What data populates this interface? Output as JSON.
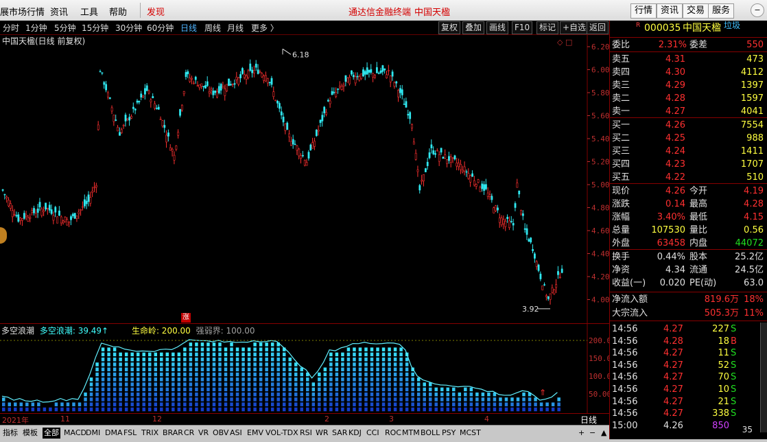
{
  "menubar": {
    "items": [
      "展市场行情",
      "资讯",
      "工具",
      "帮助"
    ],
    "discover": "发现",
    "center_left": "通达信金融终端",
    "center_right": "中国天楹",
    "right_buttons": [
      "行情",
      "资讯",
      "交易",
      "服务"
    ]
  },
  "toolbar": {
    "periods": [
      "分时",
      "1分钟",
      "5分钟",
      "15分钟",
      "30分钟",
      "60分钟",
      "日线",
      "周线",
      "月线",
      "更多 〉"
    ],
    "selected": "日线",
    "buttons": [
      "复权",
      "叠加",
      "画线",
      "F10",
      "标记",
      "+自选",
      "返回"
    ]
  },
  "chart": {
    "title": "中国天楹(日线 前复权)",
    "high_label": "6.18",
    "low_label": "3.92",
    "y_ticks": [
      "6.20",
      "6.00",
      "5.80",
      "5.60",
      "5.40",
      "5.20",
      "5.00",
      "4.80",
      "4.60",
      "4.40",
      "4.20",
      "4.00"
    ],
    "zhang_badge": "涨",
    "colors": {
      "up": "#ff3030",
      "down": "#30e8f0",
      "bg": "#000000",
      "grid": "#800000"
    }
  },
  "indicator": {
    "name": "多空浪潮",
    "label1": "多空浪潮: 39.49↑",
    "label2": "生命岭: 200.00",
    "label3": "强弱界: 100.00",
    "y_ticks": [
      "200.00",
      "150.00",
      "100.00",
      "50.00"
    ]
  },
  "date_axis": {
    "labels": [
      "2021年",
      "11",
      "12",
      "2",
      "3",
      "4"
    ],
    "period_tag": "日线"
  },
  "tabs": [
    "指标",
    "模板",
    "全部",
    "MACD",
    "DMI",
    "DMA",
    "FSL",
    "TRIX",
    "BRAR",
    "CR",
    "VR",
    "OBV",
    "ASI",
    "EMV",
    "VOL-TDX",
    "RSI",
    "WR",
    "SAR",
    "KDJ",
    "CCI",
    "ROC",
    "MTM",
    "BOLL",
    "PSY",
    "MCST"
  ],
  "tabs_selected": "全部",
  "tab_controls": [
    "+",
    "−",
    "▲",
    "◀",
    "▶"
  ],
  "stock": {
    "marker": "R",
    "code": "000035",
    "name": "中国天楹",
    "extra": "垃圾"
  },
  "quote": {
    "weibi_label": "委比",
    "weibi": "2.31%",
    "weicha_label": "委差",
    "weicha": "550",
    "asks": [
      {
        "label": "卖五",
        "price": "4.31",
        "vol": "473"
      },
      {
        "label": "卖四",
        "price": "4.30",
        "vol": "4112"
      },
      {
        "label": "卖三",
        "price": "4.29",
        "vol": "1397"
      },
      {
        "label": "卖二",
        "price": "4.28",
        "vol": "1597"
      },
      {
        "label": "卖一",
        "price": "4.27",
        "vol": "4041"
      }
    ],
    "bids": [
      {
        "label": "买一",
        "price": "4.26",
        "vol": "7554"
      },
      {
        "label": "买二",
        "price": "4.25",
        "vol": "988"
      },
      {
        "label": "买三",
        "price": "4.24",
        "vol": "1411"
      },
      {
        "label": "买四",
        "price": "4.23",
        "vol": "1707"
      },
      {
        "label": "买五",
        "price": "4.22",
        "vol": "510"
      }
    ],
    "stats": [
      {
        "l": "现价",
        "v": "4.26",
        "l2": "今开",
        "v2": "4.19"
      },
      {
        "l": "涨跌",
        "v": "0.14",
        "l2": "最高",
        "v2": "4.28"
      },
      {
        "l": "涨幅",
        "v": "3.40%",
        "l2": "最低",
        "v2": "4.15"
      },
      {
        "l": "总量",
        "v": "107530",
        "l2": "量比",
        "v2": "0.56"
      },
      {
        "l": "外盘",
        "v": "63458",
        "l2": "内盘",
        "v2": "44072"
      }
    ],
    "fund": [
      {
        "l": "换手",
        "v": "0.44%",
        "l2": "股本",
        "v2": "25.2亿"
      },
      {
        "l": "净资",
        "v": "4.34",
        "l2": "流通",
        "v2": "24.5亿"
      },
      {
        "l": "收益(一)",
        "v": "0.020",
        "l2": "PE(动)",
        "v2": "63.0"
      }
    ],
    "flow": [
      {
        "l": "净流入额",
        "v": "819.6万",
        "v2": "18%"
      },
      {
        "l": "大宗流入",
        "v": "505.3万",
        "v2": "11%"
      }
    ]
  },
  "ticks": [
    {
      "t": "14:56",
      "p": "4.27",
      "v": "227",
      "s": "S"
    },
    {
      "t": "14:56",
      "p": "4.28",
      "v": "18",
      "s": "B"
    },
    {
      "t": "14:56",
      "p": "4.27",
      "v": "11",
      "s": "S"
    },
    {
      "t": "14:56",
      "p": "4.27",
      "v": "52",
      "s": "S"
    },
    {
      "t": "14:56",
      "p": "4.27",
      "v": "70",
      "s": "S"
    },
    {
      "t": "14:56",
      "p": "4.27",
      "v": "10",
      "s": "S"
    },
    {
      "t": "14:56",
      "p": "4.27",
      "v": "21",
      "s": "S"
    },
    {
      "t": "14:56",
      "p": "4.27",
      "v": "338",
      "s": "S"
    },
    {
      "t": "15:00",
      "p": "4.26",
      "v": "850",
      "s": ""
    }
  ],
  "tick_page": "35"
}
